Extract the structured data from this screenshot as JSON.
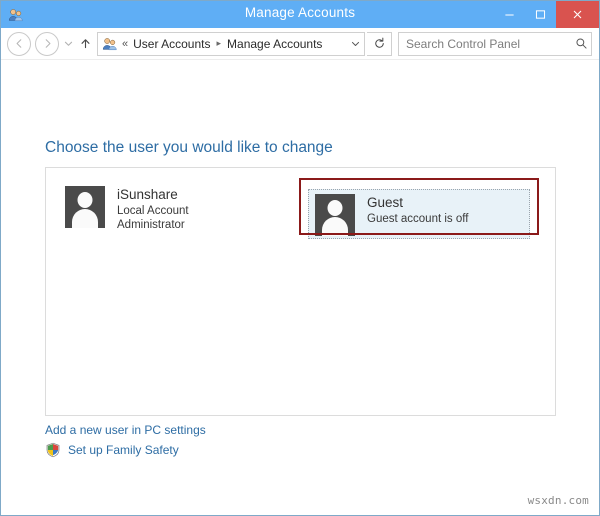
{
  "window": {
    "title": "Manage Accounts",
    "icon": "user-accounts-icon",
    "border_color": "#7FA9C8",
    "titlebar_color": "#5FAEF5",
    "caption_buttons": {
      "minimize": "minimize-icon",
      "maximize": "maximize-icon",
      "close": "close-icon",
      "close_color": "#D9534F"
    }
  },
  "addressbar": {
    "back": "back-arrow-icon",
    "forward": "forward-arrow-icon",
    "recent_dropdown": "chevron-down-icon",
    "up": "up-arrow-icon",
    "crumb_icon": "user-accounts-icon",
    "overflow_separator": "«",
    "crumbs": [
      {
        "label": "User Accounts"
      },
      {
        "label": "Manage Accounts"
      }
    ],
    "crumb_separator": "▸",
    "path_dropdown": "chevron-down-icon",
    "refresh": "refresh-icon",
    "search": {
      "placeholder": "Search Control Panel",
      "value": "",
      "icon": "search-icon"
    }
  },
  "main": {
    "heading": "Choose the user you would like to change",
    "heading_color": "#2E6DA4",
    "accounts": [
      {
        "name": "iSunshare",
        "line2": "Local Account",
        "line3": "Administrator",
        "avatar": "user-avatar-icon",
        "selected": false,
        "annotated": false
      },
      {
        "name": "Guest",
        "line2": "Guest account is off",
        "line3": "",
        "avatar": "user-avatar-icon",
        "selected": true,
        "annotated": true,
        "selection_color": "#E8F2F8",
        "annotation_color": "#8B1A1A"
      }
    ],
    "links": [
      {
        "label": "Add a new user in PC settings",
        "icon": ""
      },
      {
        "label": "Set up Family Safety",
        "icon": "shield-icon"
      }
    ],
    "link_color": "#2E6DA4"
  },
  "watermark": "wsxdn.com"
}
